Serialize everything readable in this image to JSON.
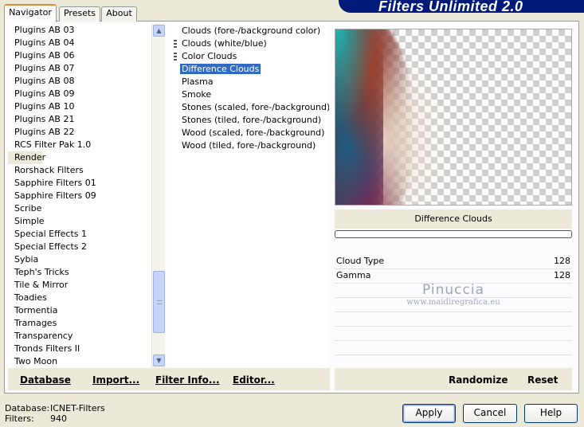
{
  "app": {
    "title": "Filters Unlimited 2.0"
  },
  "tabs": [
    {
      "label": "Navigator",
      "active": true
    },
    {
      "label": "Presets",
      "active": false
    },
    {
      "label": "About",
      "active": false
    }
  ],
  "categories": {
    "items": [
      "Plugins AB 03",
      "Plugins AB 04",
      "Plugins AB 06",
      "Plugins AB 07",
      "Plugins AB 08",
      "Plugins AB 09",
      "Plugins AB 10",
      "Plugins AB 21",
      "Plugins AB 22",
      "RCS Filter Pak 1.0",
      "Render",
      "Rorshack Filters",
      "Sapphire Filters 01",
      "Sapphire Filters 09",
      "Scribe",
      "Simple",
      "Special Effects 1",
      "Special Effects 2",
      "Sybia",
      "Teph's Tricks",
      "Tile & Mirror",
      "Toadies",
      "Tormentia",
      "Tramages",
      "Transparency",
      "Tronds Filters II",
      "Two Moon"
    ],
    "selected": "Render"
  },
  "filters": {
    "items": [
      {
        "label": "Clouds (fore-/background color)",
        "marked": false
      },
      {
        "label": "Clouds (white/blue)",
        "marked": true
      },
      {
        "label": "Color Clouds",
        "marked": true
      },
      {
        "label": "Difference Clouds",
        "marked": false
      },
      {
        "label": "Plasma",
        "marked": false
      },
      {
        "label": "Smoke",
        "marked": false
      },
      {
        "label": "Stones (scaled, fore-/background)",
        "marked": false
      },
      {
        "label": "Stones (tiled, fore-/background)",
        "marked": false
      },
      {
        "label": "Wood (scaled, fore-/background)",
        "marked": false
      },
      {
        "label": "Wood (tiled, fore-/background)",
        "marked": false
      }
    ],
    "selected": "Difference Clouds"
  },
  "preview": {
    "filter_name": "Difference Clouds"
  },
  "params": [
    {
      "label": "Cloud Type",
      "value": "128"
    },
    {
      "label": "Gamma",
      "value": "128"
    }
  ],
  "watermark": {
    "line1": "Pinuccia",
    "line2": "www.maidiregrafica.eu"
  },
  "bottom_left": {
    "database": "Database",
    "import": "Import...",
    "filter_info": "Filter Info...",
    "editor": "Editor..."
  },
  "bottom_right": {
    "randomize": "Randomize",
    "reset": "Reset"
  },
  "status": {
    "database_label": "Database:",
    "database_value": "ICNET-Filters",
    "filters_label": "Filters:",
    "filters_value": "940"
  },
  "buttons": {
    "apply": "Apply",
    "cancel": "Cancel",
    "help": "Help"
  }
}
